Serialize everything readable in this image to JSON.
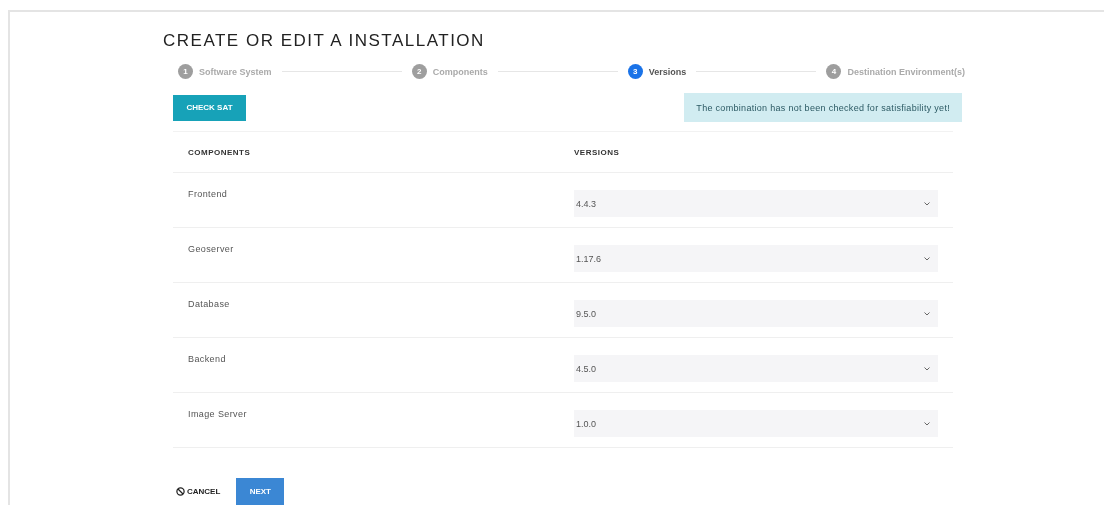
{
  "title": "CREATE OR EDIT A INSTALLATION",
  "steps": [
    {
      "number": "1",
      "label": "Software System",
      "selected": false
    },
    {
      "number": "2",
      "label": "Components",
      "selected": false
    },
    {
      "number": "3",
      "label": "Versions",
      "selected": true
    },
    {
      "number": "4",
      "label": "Destination Environment(s)",
      "selected": false
    }
  ],
  "check_button": "CHECK SAT",
  "alert": "The combination has not been checked for satisfiability yet!",
  "table": {
    "columns": [
      "COMPONENTS",
      "VERSIONS"
    ],
    "rows": [
      {
        "component": "Frontend",
        "version": "4.4.3"
      },
      {
        "component": "Geoserver",
        "version": "1.17.6"
      },
      {
        "component": "Database",
        "version": "9.5.0"
      },
      {
        "component": "Backend",
        "version": "4.5.0"
      },
      {
        "component": "Image Server",
        "version": "1.0.0"
      }
    ]
  },
  "cancel_button": "CANCEL",
  "next_button": "NEXT"
}
